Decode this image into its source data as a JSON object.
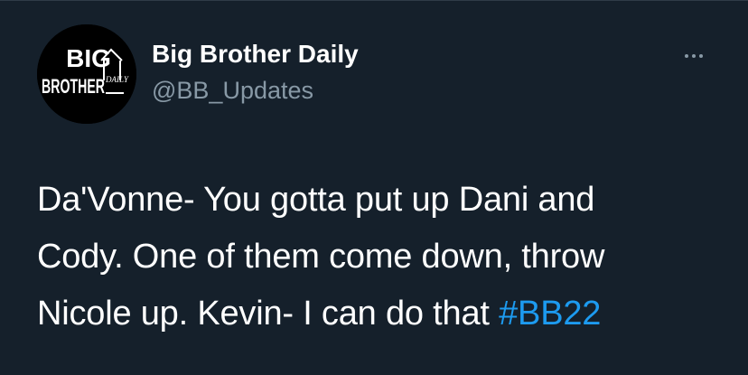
{
  "tweet": {
    "author": {
      "display_name": "Big Brother Daily",
      "handle": "@BB_Updates",
      "avatar_icon": "big-brother-logo-icon",
      "logo_text": {
        "word1": "BIG",
        "word2": "BROTHER",
        "tag": "DAILY"
      }
    },
    "more_icon": "more-horizontal-icon",
    "text_lines": [
      "Da'Vonne- You gotta put up Dani and",
      "Cody. One of them come down, throw",
      "Nicole up. Kevin- I can do that "
    ],
    "hashtag": "#BB22"
  },
  "colors": {
    "background": "#15202b",
    "primary_text": "#ffffff",
    "secondary_text": "#8899a6",
    "link": "#1d9bf0"
  }
}
